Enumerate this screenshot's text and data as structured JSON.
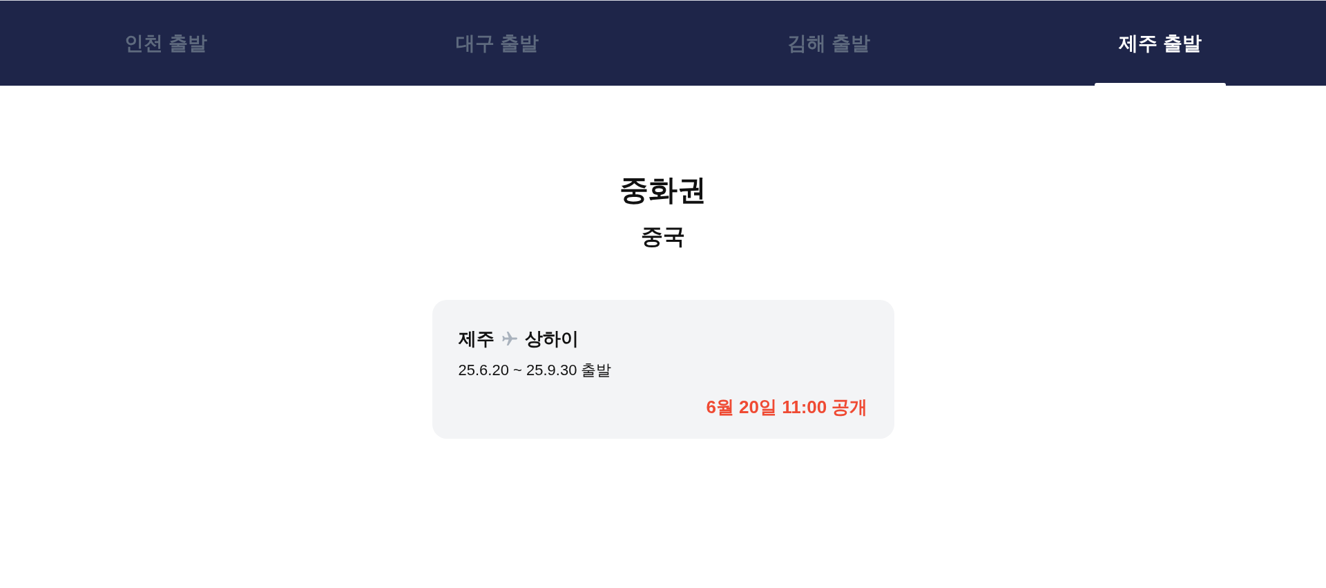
{
  "tabs": [
    {
      "label": "인천 출발",
      "selected": false
    },
    {
      "label": "대구 출발",
      "selected": false
    },
    {
      "label": "김해 출발",
      "selected": false
    },
    {
      "label": "제주 출발",
      "selected": true
    }
  ],
  "region": {
    "title": "중화권",
    "subtitle": "중국"
  },
  "flights": [
    {
      "origin": "제주",
      "destination": "상하이",
      "period": "25.6.20 ~ 25.9.30 출발",
      "release": "6월 20일 11:00 공개"
    }
  ]
}
